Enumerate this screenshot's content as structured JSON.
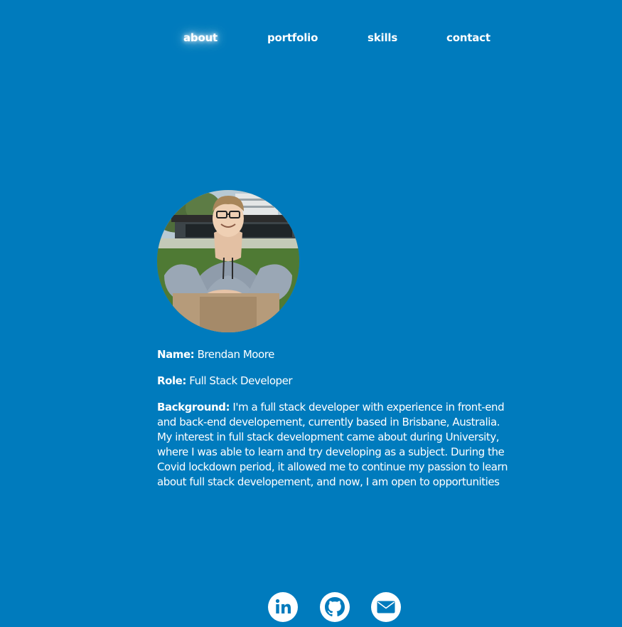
{
  "nav": {
    "items": [
      {
        "label": "about",
        "active": true
      },
      {
        "label": "portfolio",
        "active": false
      },
      {
        "label": "skills",
        "active": false
      },
      {
        "label": "contact",
        "active": false
      }
    ]
  },
  "profile": {
    "photo_icon": "profile-photo",
    "name_label": "Name:",
    "name_value": "Brendan Moore",
    "role_label": "Role:",
    "role_value": "Full Stack Developer",
    "background_label": "Background:",
    "background_value": "I'm a full stack developer with experience in front-end and back-end developement, currently based in Brisbane, Australia. My interest in full stack development came about during University, where I was able to learn and try developing as a subject. During the Covid lockdown period, it allowed me to continue my passion to learn about full stack developement, and now, I am open to opportunities"
  },
  "social": {
    "icons": [
      "linkedin-icon",
      "github-icon",
      "email-icon"
    ]
  },
  "colors": {
    "background": "#007bbd",
    "text": "#ffffff"
  }
}
